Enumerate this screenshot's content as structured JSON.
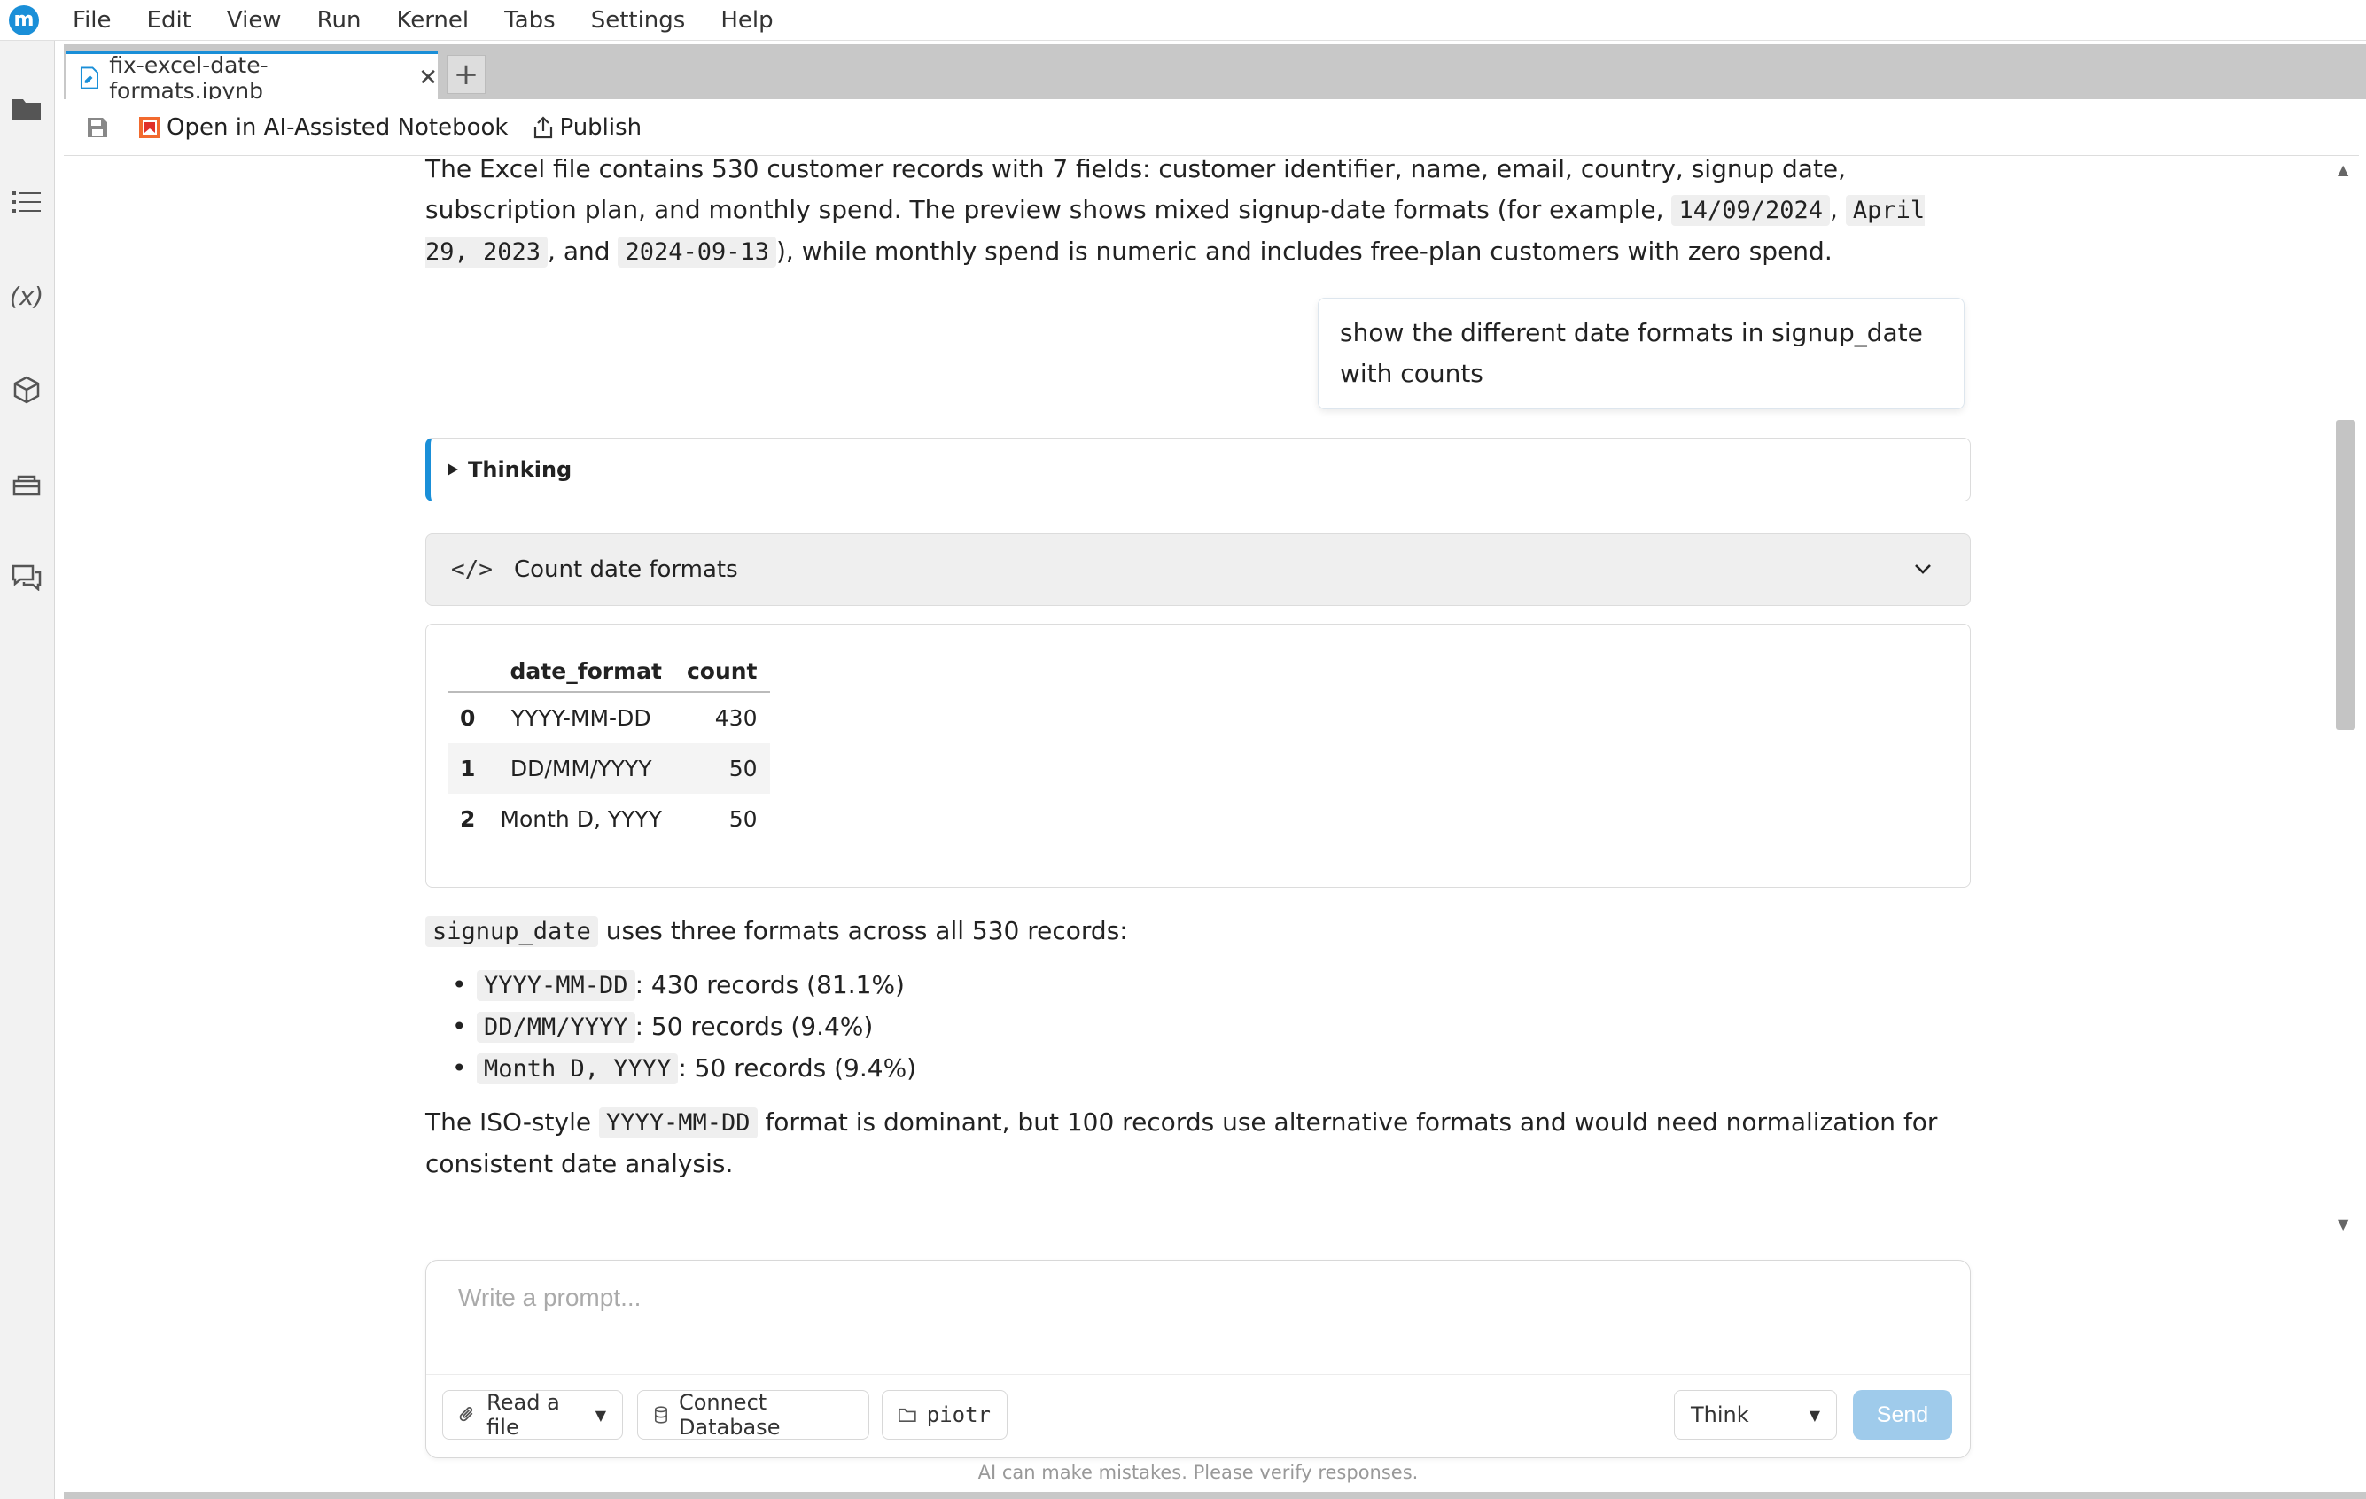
{
  "menubar": {
    "logo": "m",
    "items": [
      "File",
      "Edit",
      "View",
      "Run",
      "Kernel",
      "Tabs",
      "Settings",
      "Help"
    ]
  },
  "sidebar": {
    "icons": [
      "folder-icon",
      "table-of-contents-icon",
      "variables-icon",
      "extensions-icon",
      "ai-assistant-icon",
      "chat-icon"
    ],
    "variables_glyph": "(x)"
  },
  "tab": {
    "filename": "fix-excel-date-formats.ipynb",
    "close": "✕",
    "new_tab": "+"
  },
  "toolbar": {
    "open_ai_label": "Open in AI-Assisted Notebook",
    "publish_label": "Publish"
  },
  "chat": {
    "intro_part1": "The Excel file contains 530 customer records with 7 fields: customer identifier, name, email, country, signup date, subscription plan, and monthly spend. The preview shows mixed signup-date formats (for example, ",
    "intro_code1": "14/09/2024",
    "intro_sep1": ", ",
    "intro_code2": "April 29, 2023",
    "intro_sep2": ", and ",
    "intro_code3": "2024-09-13",
    "intro_part2": "), while monthly spend is numeric and includes free-plan customers with zero spend.",
    "user_message": "show the different date formats in signup_date with counts",
    "thinking_label": "Thinking",
    "code_tag": "</>",
    "code_cell_label": "Count date formats",
    "table": {
      "headers": [
        "",
        "date_format",
        "count"
      ],
      "rows": [
        {
          "idx": "0",
          "fmt": "YYYY-MM-DD",
          "count": "430"
        },
        {
          "idx": "1",
          "fmt": "DD/MM/YYYY",
          "count": "50"
        },
        {
          "idx": "2",
          "fmt": "Month D, YYYY",
          "count": "50"
        }
      ]
    },
    "summary_code": "signup_date",
    "summary_text": " uses three formats across all 530 records:",
    "bullets": [
      {
        "code": "YYYY-MM-DD",
        "text": ": 430 records (81.1%)"
      },
      {
        "code": "DD/MM/YYYY",
        "text": ": 50 records (9.4%)"
      },
      {
        "code": "Month D, YYYY",
        "text": ": 50 records (9.4%)"
      }
    ],
    "conclusion_part1": "The ISO-style ",
    "conclusion_code": "YYYY-MM-DD",
    "conclusion_part2": " format is dominant, but 100 records use alternative formats and would need normalization for consistent date analysis."
  },
  "prompt": {
    "placeholder": "Write a prompt...",
    "read_file_label": "Read a file",
    "connect_db_label": "Connect Database",
    "folder_label": "piotr",
    "mode_label": "Think",
    "send_label": "Send",
    "disclaimer": "AI can make mistakes. Please verify responses."
  },
  "colors": {
    "accent": "#1a8fd8",
    "send_disabled": "#9fcbeb"
  }
}
